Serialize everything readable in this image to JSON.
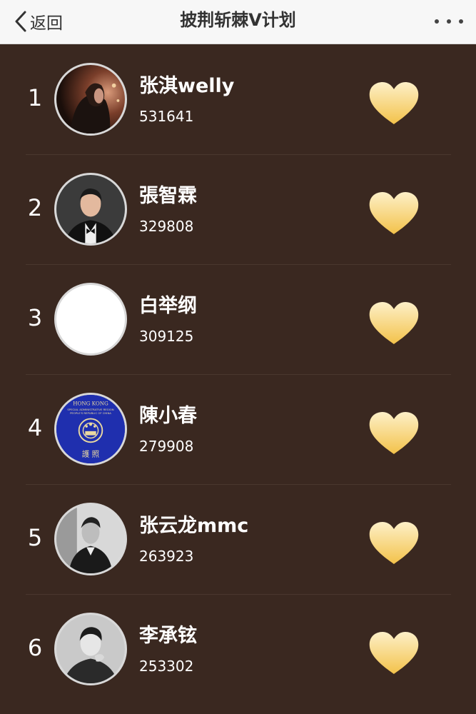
{
  "header": {
    "back_label": "返回",
    "title": "披荆斩棘V计划"
  },
  "ranking": [
    {
      "rank": "1",
      "name": "张淇welly",
      "count": "531641",
      "avatar": "photo-long-hair-man"
    },
    {
      "rank": "2",
      "name": "張智霖",
      "count": "329808",
      "avatar": "photo-man-in-tuxedo"
    },
    {
      "rank": "3",
      "name": "白举纲",
      "count": "309125",
      "avatar": "blank-white"
    },
    {
      "rank": "4",
      "name": "陳小春",
      "count": "279908",
      "avatar": "hong-kong-passport",
      "avatar_text": {
        "top": "HONG KONG",
        "line1": "SPECIAL ADMINISTRATIVE REGION",
        "line2": "PEOPLE'S REPUBLIC OF CHINA",
        "bottom": "護 照"
      }
    },
    {
      "rank": "5",
      "name": "张云龙mmc",
      "count": "263923",
      "avatar": "photo-man-in-suit-bw"
    },
    {
      "rank": "6",
      "name": "李承铉",
      "count": "253302",
      "avatar": "photo-man-bw"
    }
  ],
  "colors": {
    "background": "#3a2820",
    "header_bg": "#f7f7f7",
    "heart_top": "#fdf0c8",
    "heart_bottom": "#f3c24a"
  },
  "icons": {
    "back": "chevron-left-icon",
    "more": "more-dots-icon",
    "vote": "heart-icon"
  }
}
